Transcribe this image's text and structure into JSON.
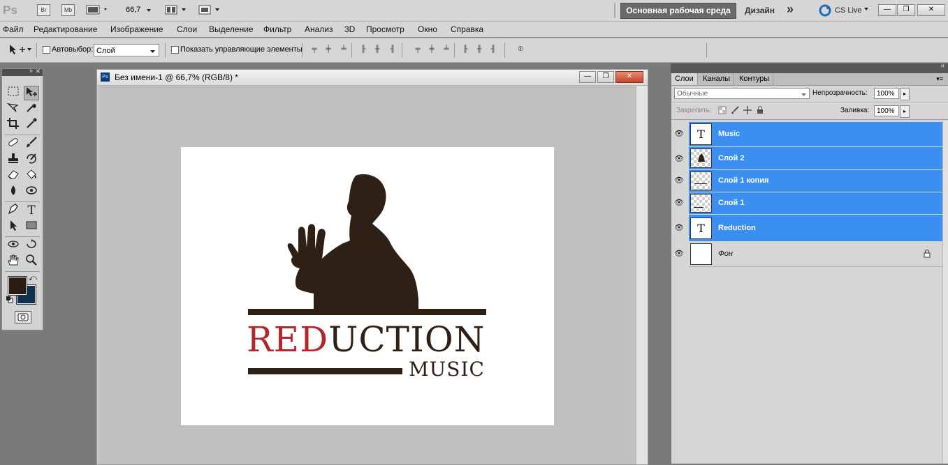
{
  "app": {
    "logo": "Ps",
    "bridge_label": "Br",
    "minibridge_label": "Mb",
    "zoom_value": "66,7",
    "workspace_active": "Основная рабочая среда",
    "workspace_design": "Дизайн",
    "more_label": "»",
    "cs_live": "CS Live",
    "window_buttons": [
      "—",
      "❐",
      "✕"
    ]
  },
  "menu": {
    "items": [
      "Файл",
      "Редактирование",
      "Изображение",
      "Слои",
      "Выделение",
      "Фильтр",
      "Анализ",
      "3D",
      "Просмотр",
      "Окно",
      "Справка"
    ]
  },
  "options": {
    "autoselect_label": "Автовыбор:",
    "autoselect_value": "Слой",
    "show_controls_label": "Показать управляющие элементы"
  },
  "document": {
    "title": "Без имени-1 @ 66,7% (RGB/8) *",
    "window_buttons": [
      "—",
      "❐",
      "✕"
    ]
  },
  "artwork": {
    "red_part": "RED",
    "dark_part": "UCTION",
    "subtitle": "MUSIC",
    "red_color": "#b3272b",
    "dark_color": "#2e2014"
  },
  "tools": {
    "foreground_color": "#2b1d13",
    "background_color": "#0f3251"
  },
  "layers_panel": {
    "tabs": [
      "Слои",
      "Каналы",
      "Контуры"
    ],
    "blend_mode": "Обычные",
    "opacity_label": "Непрозрачность:",
    "opacity_value": "100%",
    "lock_label": "Закрепить:",
    "fill_label": "Заливка:",
    "fill_value": "100%",
    "selection_color": "#3b8ff0",
    "layers": [
      {
        "name": "Music",
        "thumb": "T",
        "selected": true
      },
      {
        "name": "Слой 2",
        "thumb": "",
        "selected": true
      },
      {
        "name": "Слой 1 копия",
        "thumb": "",
        "selected": true
      },
      {
        "name": "Слой 1",
        "thumb": "",
        "selected": true
      },
      {
        "name": "Reduction",
        "thumb": "T",
        "selected": true
      },
      {
        "name": "Фон",
        "thumb": "",
        "selected": false
      }
    ]
  }
}
